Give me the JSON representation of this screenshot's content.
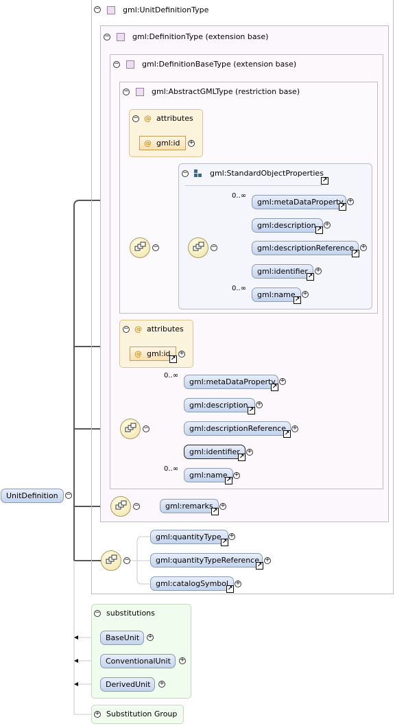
{
  "root_element": {
    "label": "UnitDefinition"
  },
  "types": {
    "unit_definition_type": "gml:UnitDefinitionType",
    "definition_type": "gml:DefinitionType (extension base)",
    "definition_base_type": "gml:DefinitionBaseType (extension base)",
    "abstract_gml_type": "gml:AbstractGMLType (restriction base)"
  },
  "attributes_label": "attributes",
  "attribute_gml_id": "gml:id",
  "attribute_at_symbol": "@",
  "standard_object_properties": {
    "label": "gml:StandardObjectProperties",
    "multiplicity_first": "0..∞",
    "multiplicity_last": "0..∞",
    "items": [
      "gml:metaDataProperty",
      "gml:description",
      "gml:descriptionReference",
      "gml:identifier",
      "gml:name"
    ]
  },
  "definition_base_sequence": {
    "multiplicity_first": "0..∞",
    "multiplicity_last": "0..∞",
    "items": [
      "gml:metaDataProperty",
      "gml:description",
      "gml:descriptionReference",
      "gml:identifier",
      "gml:name"
    ]
  },
  "definition_sequence": {
    "items": [
      "gml:remarks"
    ]
  },
  "unit_definition_choice": {
    "items": [
      "gml:quantityType",
      "gml:quantityTypeReference",
      "gml:catalogSymbol"
    ]
  },
  "substitutions": {
    "label": "substitutions",
    "items": [
      "BaseUnit",
      "ConventionalUnit",
      "DerivedUnit"
    ]
  },
  "substitution_group": {
    "label": "Substitution Group"
  },
  "colors": {
    "element_fill": "#c3d3ec",
    "attribute_fill": "#f7dfae",
    "substitutions_fill": "#f0fcee",
    "type_square": "#ecdff0"
  }
}
